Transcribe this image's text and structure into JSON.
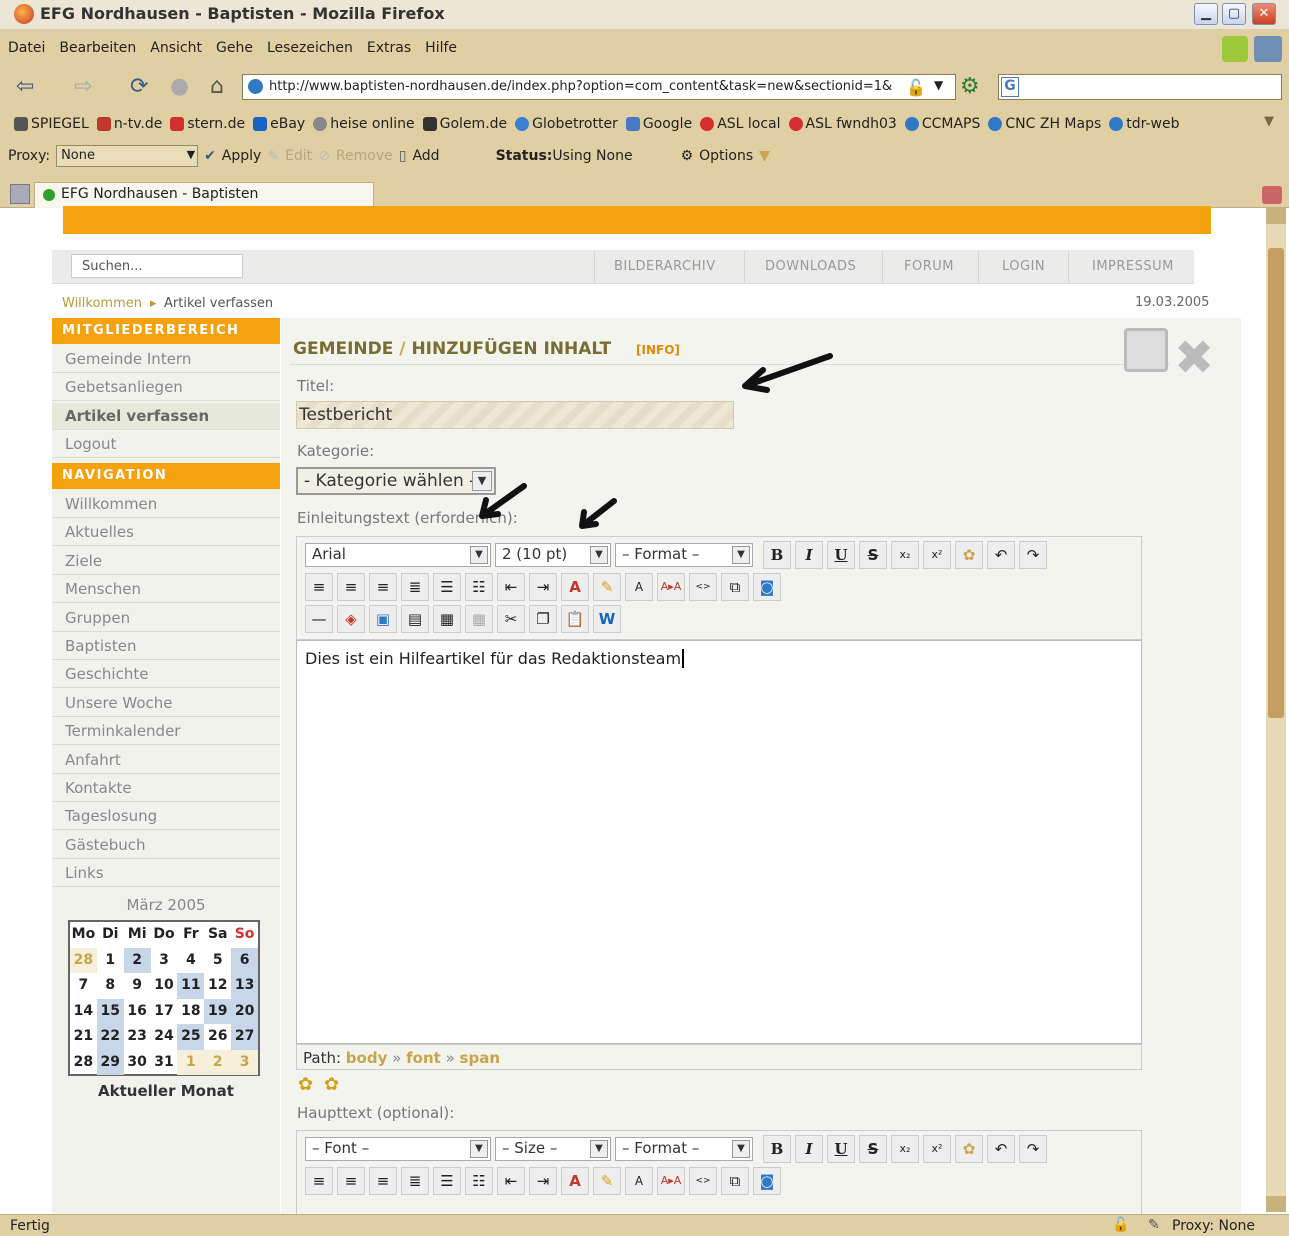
{
  "window": {
    "title": "EFG Nordhausen - Baptisten - Mozilla Firefox",
    "min": "▁",
    "max": "▢",
    "close": "✕"
  },
  "menu": [
    "Datei",
    "Bearbeiten",
    "Ansicht",
    "Gehe",
    "Lesezeichen",
    "Extras",
    "Hilfe"
  ],
  "url": "http://www.baptisten-nordhausen.de/index.php?option=com_content&task=new&sectionid=1&",
  "search_engine_icon": "G",
  "bookmarks": [
    "SPIEGEL",
    "n-tv.de",
    "stern.de",
    "eBay",
    "heise online",
    "Golem.de",
    "Globetrotter",
    "Google",
    "ASL local",
    "ASL fwndh03",
    "CCMAPS",
    "CNC ZH Maps",
    "tdr-web"
  ],
  "proxy": {
    "label": "Proxy:",
    "value": "None",
    "apply": "Apply",
    "edit": "Edit",
    "remove": "Remove",
    "add": "Add",
    "status_label": "Status:",
    "status_value": "Using None",
    "options": "Options"
  },
  "tab": {
    "title": "EFG Nordhausen - Baptisten"
  },
  "site": {
    "search_placeholder": "Suchen...",
    "topnav": [
      "BILDERARCHIV",
      "DOWNLOADS",
      "FORUM",
      "LOGIN",
      "IMPRESSUM"
    ],
    "breadcrumb": [
      "Willkommen",
      "Artikel verfassen"
    ],
    "date": "19.03.2005",
    "members_head": "MITGLIEDERBEREICH",
    "members_items": [
      "Gemeinde Intern",
      "Gebetsanliegen",
      "Artikel verfassen",
      "Logout"
    ],
    "nav_head": "NAVIGATION",
    "nav_items": [
      "Willkommen",
      "Aktuelles",
      "Ziele",
      "Menschen",
      "Gruppen",
      "Baptisten",
      "Geschichte",
      "Unsere Woche",
      "Terminkalender",
      "Anfahrt",
      "Kontakte",
      "Tageslosung",
      "Gästebuch",
      "Links"
    ]
  },
  "calendar": {
    "month": "März 2005",
    "headers": [
      "Mo",
      "Di",
      "Mi",
      "Do",
      "Fr",
      "Sa",
      "So"
    ],
    "days": [
      "28",
      "1",
      "2",
      "3",
      "4",
      "5",
      "6",
      "7",
      "8",
      "9",
      "10",
      "11",
      "12",
      "13",
      "14",
      "15",
      "16",
      "17",
      "18",
      "19",
      "20",
      "21",
      "22",
      "23",
      "24",
      "25",
      "26",
      "27",
      "28",
      "29",
      "30",
      "31",
      "1",
      "2",
      "3"
    ],
    "footer": "Aktueller Monat"
  },
  "form": {
    "title_section": "GEMEINDE",
    "title_sep": "/",
    "title_action": "HINZUFÜGEN",
    "title_rest": "INHALT",
    "info": "[INFO]",
    "titel_label": "Titel:",
    "titel_value": "Testbericht",
    "kategorie_label": "Kategorie:",
    "kategorie_value": "- Kategorie wählen -",
    "intro_label": "Einleitungstext (erforderlich):",
    "editor1": {
      "font": "Arial",
      "size": "2 (10 pt)",
      "format": "– Format –",
      "content": "Dies ist ein Hilfeartikel für das Redaktionsteam",
      "path_label": "Path:",
      "path": [
        "body",
        "font",
        "span"
      ]
    },
    "main_label": "Haupttext (optional):",
    "editor2": {
      "font": "– Font –",
      "size": "– Size –",
      "format": "– Format –"
    }
  },
  "status": {
    "left": "Fertig",
    "right": "Proxy: None"
  }
}
